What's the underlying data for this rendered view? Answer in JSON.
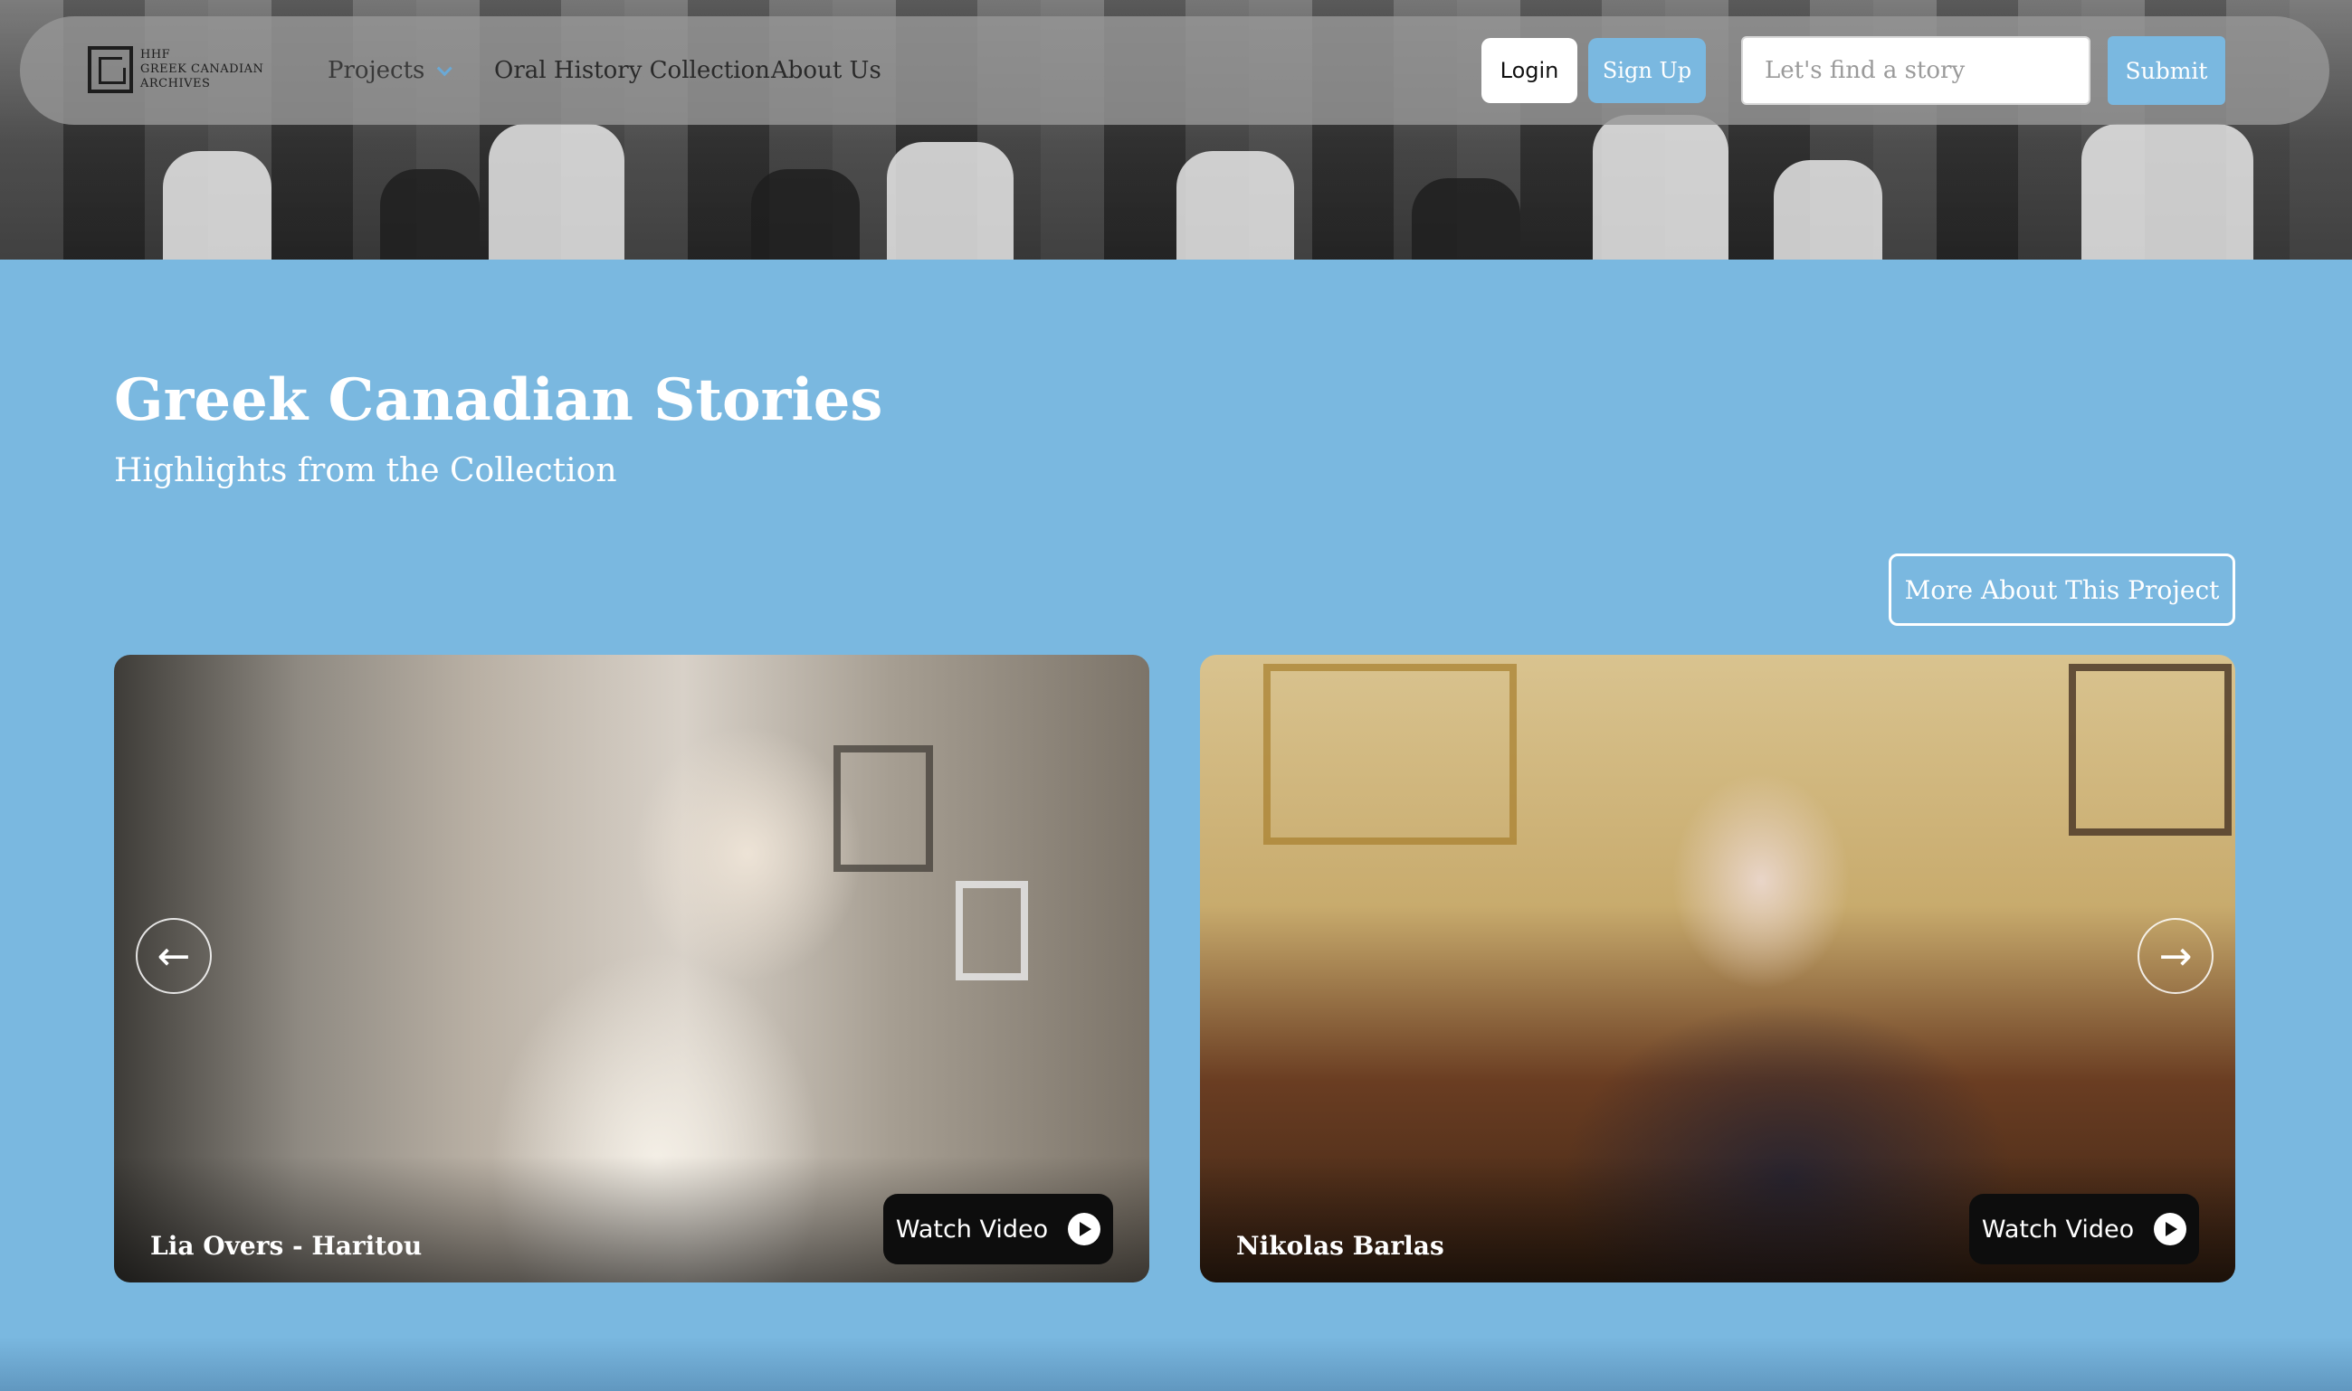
{
  "logo": {
    "lines": [
      "HHF",
      "GREEK CANADIAN",
      "ARCHIVES"
    ]
  },
  "nav": {
    "projects": "Projects",
    "oral_history": "Oral History Collection",
    "about": "About Us",
    "login": "Login",
    "signup": "Sign Up",
    "search_placeholder": "Let's find a story",
    "submit": "Submit"
  },
  "section": {
    "title": "Greek Canadian Stories",
    "subtitle": "Highlights from the Collection",
    "more_button": "More About This Project"
  },
  "cards": [
    {
      "name": "Lia Overs - Haritou",
      "watch_label": "Watch Video"
    },
    {
      "name": "Nikolas Barlas",
      "watch_label": "Watch Video"
    }
  ],
  "carousel": {
    "prev_icon": "arrow-left-icon",
    "next_icon": "arrow-right-icon"
  },
  "colors": {
    "accent": "#7ab8e0"
  }
}
